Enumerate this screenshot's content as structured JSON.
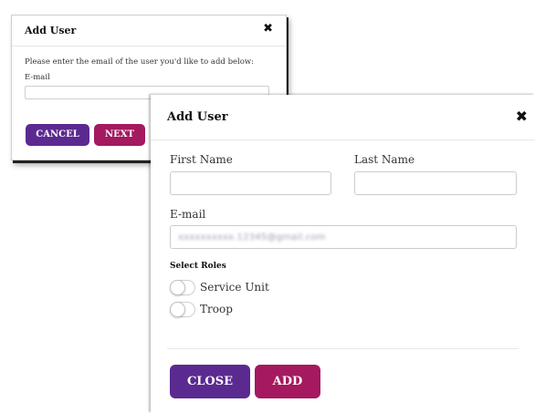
{
  "invite_dialog": {
    "title": "Add User",
    "close_glyph": "✖",
    "instruction": "Please enter the email of the user you'd like to add below:",
    "email_label": "E-mail",
    "email_value": "",
    "cancel_label": "CANCEL",
    "next_label": "NEXT"
  },
  "add_dialog": {
    "title": "Add User",
    "close_glyph": "✖",
    "first_name_label": "First Name",
    "first_name_value": "",
    "last_name_label": "Last Name",
    "last_name_value": "",
    "email_label": "E-mail",
    "email_value_redacted": "xxxxxxxxxx.12345@gmail.com",
    "roles_header": "Select Roles",
    "roles": [
      {
        "label": "Service Unit",
        "enabled": false
      },
      {
        "label": "Troop",
        "enabled": false
      }
    ],
    "close_label": "CLOSE",
    "add_label": "ADD"
  },
  "colors": {
    "primary_purple": "#5b2a91",
    "accent_magenta": "#a4195f"
  }
}
